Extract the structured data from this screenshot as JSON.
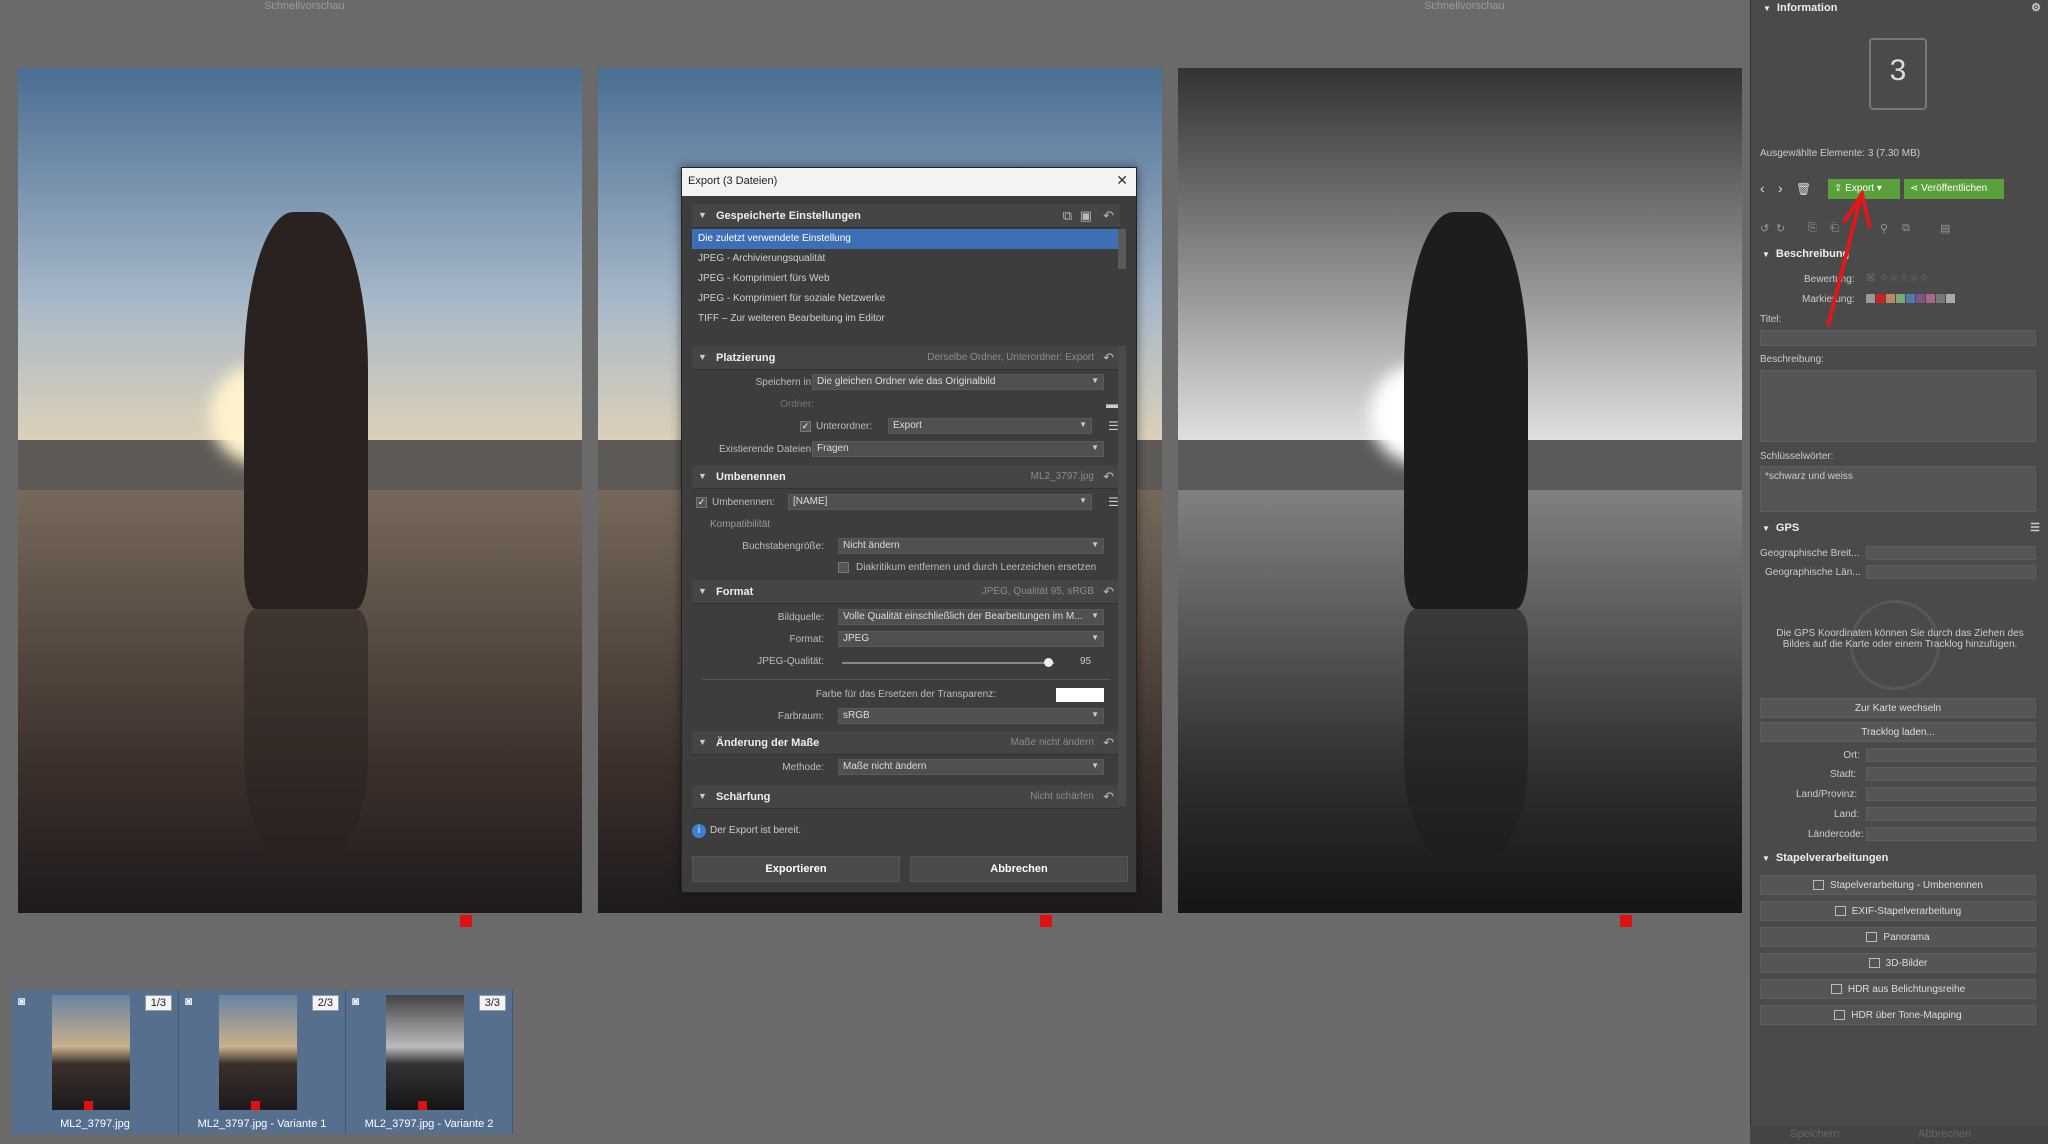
{
  "preview": {
    "label_left": "Schnellvorschau",
    "label_right": "Schnellvorschau"
  },
  "filmstrip": [
    {
      "badge": "1/3",
      "name": "ML2_3797.jpg"
    },
    {
      "badge": "2/3",
      "name": "ML2_3797.jpg - Variante 1"
    },
    {
      "badge": "3/3",
      "name": "ML2_3797.jpg - Variante 2"
    }
  ],
  "dialog": {
    "title": "Export (3 Dateien)",
    "presets_header": "Gespeicherte Einstellungen",
    "presets": [
      "Die zuletzt verwendete Einstellung",
      "JPEG - Archivierungsqualität",
      "JPEG - Komprimiert fürs Web",
      "JPEG - Komprimiert für soziale Netzwerke",
      "TIFF – Zur weiteren Bearbeitung im Editor"
    ],
    "placement": {
      "title": "Platzierung",
      "summary": "Derselbe Ordner, Unterordner: Export",
      "save_in_label": "Speichern in:",
      "save_in_value": "Die gleichen Ordner wie das Originalbild",
      "folder_label": "Ordner:",
      "subfolder_label": "Unterordner:",
      "subfolder_value": "Export",
      "existing_label": "Existierende Dateien:",
      "existing_value": "Fragen"
    },
    "rename": {
      "title": "Umbenennen",
      "summary": "ML2_3797.jpg",
      "rename_label": "Umbenennen:",
      "rename_value": "[NAME]",
      "compat_label": "Kompatibilität",
      "case_label": "Buchstabengröße:",
      "case_value": "Nicht ändern",
      "diacritics_label": "Diakritikum entfernen und durch Leerzeichen ersetzen"
    },
    "format": {
      "title": "Format",
      "summary": "JPEG, Qualität 95, sRGB",
      "source_label": "Bildquelle:",
      "source_value": "Volle Qualität einschließlich der Bearbeitungen im M...",
      "format_label": "Format:",
      "format_value": "JPEG",
      "quality_label": "JPEG-Qualität:",
      "quality_value": "95",
      "transparency_label": "Farbe für das Ersetzen der Transparenz:",
      "colorspace_label": "Farbraum:",
      "colorspace_value": "sRGB"
    },
    "resize": {
      "title": "Änderung der Maße",
      "summary": "Maße nicht ändern",
      "method_label": "Methode:",
      "method_value": "Maße nicht ändern"
    },
    "sharpen": {
      "title": "Schärfung",
      "summary": "Nicht schärfen"
    },
    "status": "Der Export ist bereit.",
    "export_button": "Exportieren",
    "cancel_button": "Abbrechen"
  },
  "panel": {
    "info_title": "Information",
    "count": "3",
    "selected": "Ausgewählte Elemente: 3 (7.30 MB)",
    "export_btn": "Export",
    "publish_btn": "Veröffentlichen",
    "description_title": "Beschreibung",
    "rating_label": "Bewertung:",
    "marking_label": "Markierung:",
    "title_label": "Titel:",
    "desc_label": "Beschreibung:",
    "keywords_label": "Schlüsselwörter:",
    "keywords_value": "*schwarz und weiss",
    "gps_title": "GPS",
    "lat_label": "Geographische Breit...",
    "lon_label": "Geographische Län...",
    "gps_hint_1": "Die GPS Koordinaten können Sie durch das Ziehen des",
    "gps_hint_2": "Bildes auf die Karte oder einem Tracklog hinzufügen.",
    "map_btn": "Zur Karte wechseln",
    "tracklog_btn": "Tracklog laden...",
    "place_label": "Ort:",
    "city_label": "Stadt:",
    "region_label": "Land/Provinz:",
    "country_label": "Land:",
    "country_code_label": "Ländercode:",
    "batch_title": "Stapelverarbeitungen",
    "batch": [
      "Stapelverarbeitung - Umbenennen",
      "EXIF-Stapelverarbeitung",
      "Panorama",
      "3D-Bilder",
      "HDR aus Belichtungsreihe",
      "HDR über Tone-Mapping"
    ],
    "save_btn": "Speichern",
    "cancel_btn": "Abbrechen"
  }
}
